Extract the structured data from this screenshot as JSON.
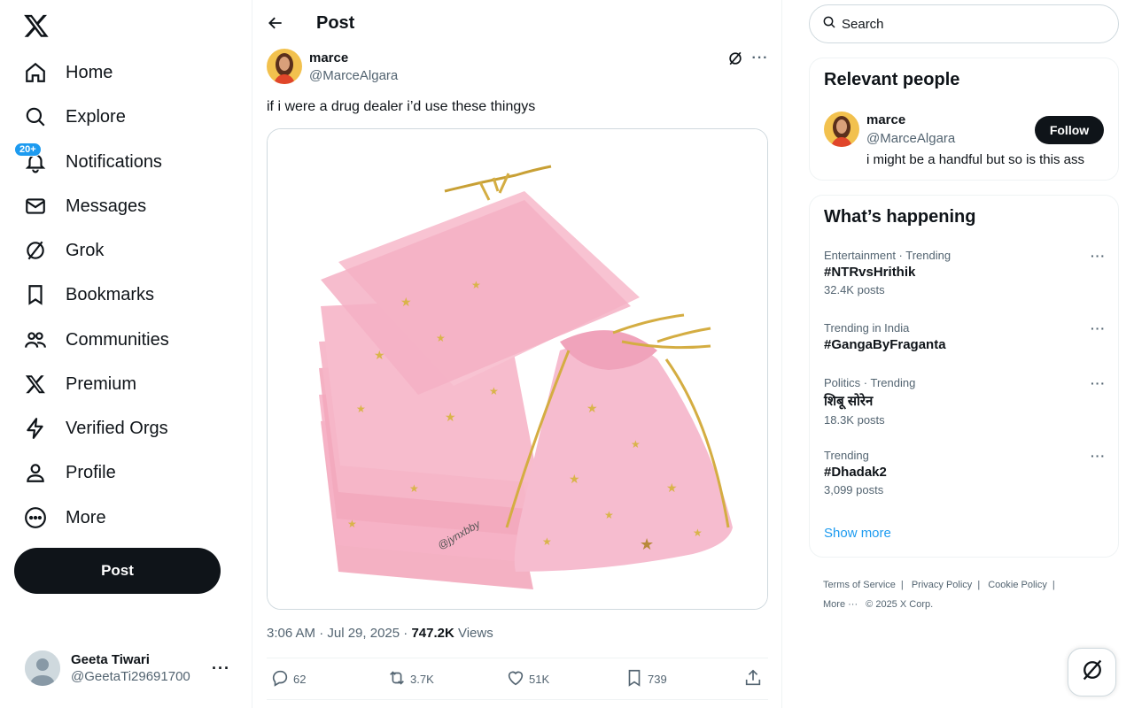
{
  "sidebar": {
    "items": [
      {
        "label": "Home",
        "icon": "home-icon"
      },
      {
        "label": "Explore",
        "icon": "search-icon"
      },
      {
        "label": "Notifications",
        "icon": "bell-icon",
        "badge": "20+"
      },
      {
        "label": "Messages",
        "icon": "envelope-icon"
      },
      {
        "label": "Grok",
        "icon": "grok-icon"
      },
      {
        "label": "Bookmarks",
        "icon": "bookmark-icon"
      },
      {
        "label": "Communities",
        "icon": "people-icon"
      },
      {
        "label": "Premium",
        "icon": "x-logo-icon"
      },
      {
        "label": "Verified Orgs",
        "icon": "lightning-icon"
      },
      {
        "label": "Profile",
        "icon": "person-icon"
      },
      {
        "label": "More",
        "icon": "more-circle-icon"
      }
    ],
    "post_label": "Post",
    "account": {
      "name": "Geeta Tiwari",
      "handle": "@GeetaTi29691700"
    }
  },
  "main": {
    "title": "Post",
    "tweet": {
      "author_name": "marce",
      "author_handle": "@MarceAlgara",
      "text": "if i were a drug dealer i’d use these thingys",
      "image_watermark": "@jynxbby",
      "time": "3:06 AM · Jul 29, 2025 · ",
      "views": "747.2K",
      "views_label": " Views",
      "replies": "62",
      "reposts": "3.7K",
      "likes": "51K",
      "bookmarks": "739"
    }
  },
  "right": {
    "search_placeholder": "Search",
    "relevant": {
      "title": "Relevant people",
      "name": "marce",
      "handle": "@MarceAlgara",
      "bio": "i might be a handful but so is this ass",
      "follow_label": "Follow"
    },
    "happening": {
      "title": "What’s happening",
      "trends": [
        {
          "context": "Entertainment · Trending",
          "name": "#NTRvsHrithik",
          "count": "32.4K posts"
        },
        {
          "context": "Trending in India",
          "name": "#GangaByFraganta",
          "count": ""
        },
        {
          "context": "Politics · Trending",
          "name": "शिबू सोरेन",
          "count": "18.3K posts"
        },
        {
          "context": "Trending",
          "name": "#Dhadak2",
          "count": "3,099 posts"
        }
      ],
      "show_more": "Show more"
    },
    "footer": {
      "links": [
        "Terms of Service",
        "Privacy Policy",
        "Cookie Policy"
      ],
      "more": "More ···",
      "copyright": "© 2025 X Corp."
    }
  },
  "colors": {
    "accent": "#1d9bf0",
    "text": "#0f1419",
    "muted": "#536471",
    "border": "#eff3f4",
    "bag_pink": "#f7b6c8"
  }
}
